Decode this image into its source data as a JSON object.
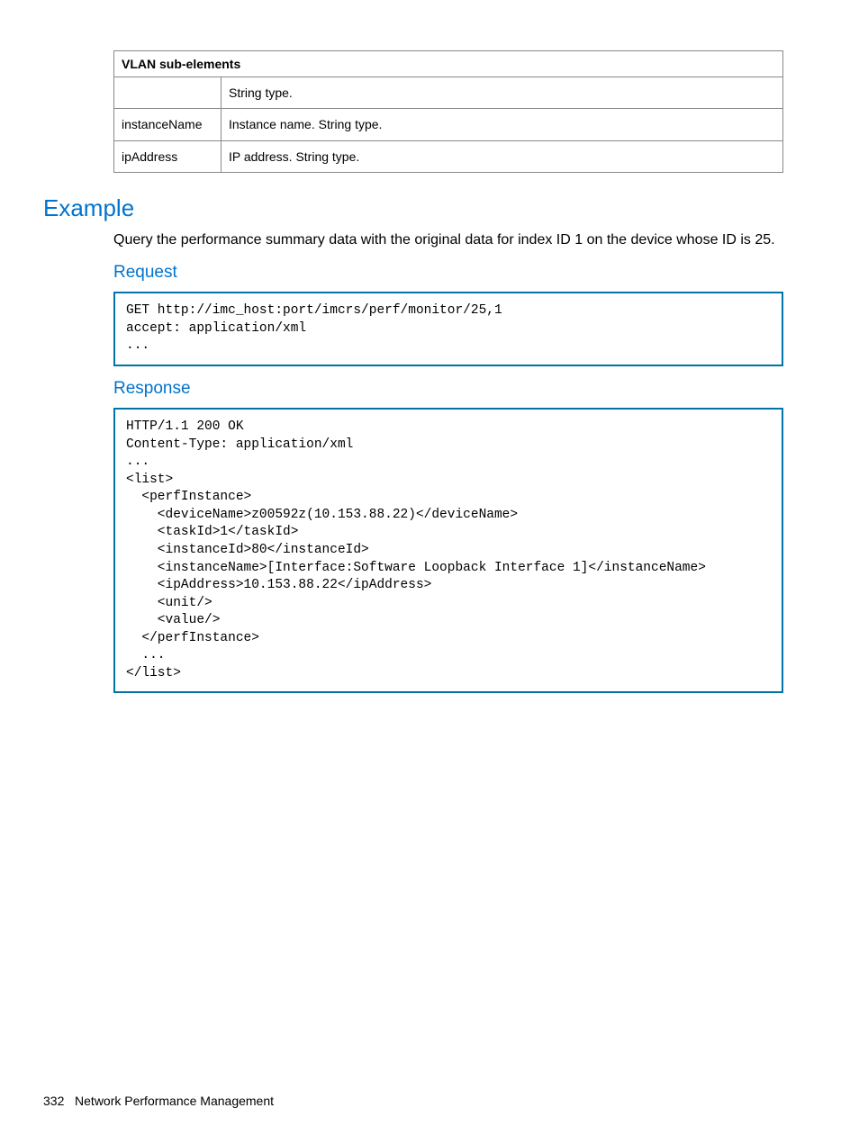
{
  "table": {
    "header": "VLAN sub-elements",
    "rows": [
      {
        "name": "",
        "desc": "String type."
      },
      {
        "name": "instanceName",
        "desc": "Instance name.\nString type."
      },
      {
        "name": "ipAddress",
        "desc": "IP address.\nString type."
      }
    ]
  },
  "sections": {
    "example_title": "Example",
    "example_body": "Query the performance summary data with the original data for index ID 1 on the device whose ID is 25.",
    "request_title": "Request",
    "request_code": "GET http://imc_host:port/imcrs/perf/monitor/25,1\naccept: application/xml\n...",
    "response_title": "Response",
    "response_code": "HTTP/1.1 200 OK\nContent-Type: application/xml\n...\n<list>\n  <perfInstance>\n    <deviceName>z00592z(10.153.88.22)</deviceName>\n    <taskId>1</taskId>\n    <instanceId>80</instanceId>\n    <instanceName>[Interface:Software Loopback Interface 1]</instanceName>\n    <ipAddress>10.153.88.22</ipAddress>\n    <unit/>\n    <value/>\n  </perfInstance>\n  ...\n</list>"
  },
  "footer": {
    "page_number": "332",
    "title": "Network Performance Management"
  }
}
